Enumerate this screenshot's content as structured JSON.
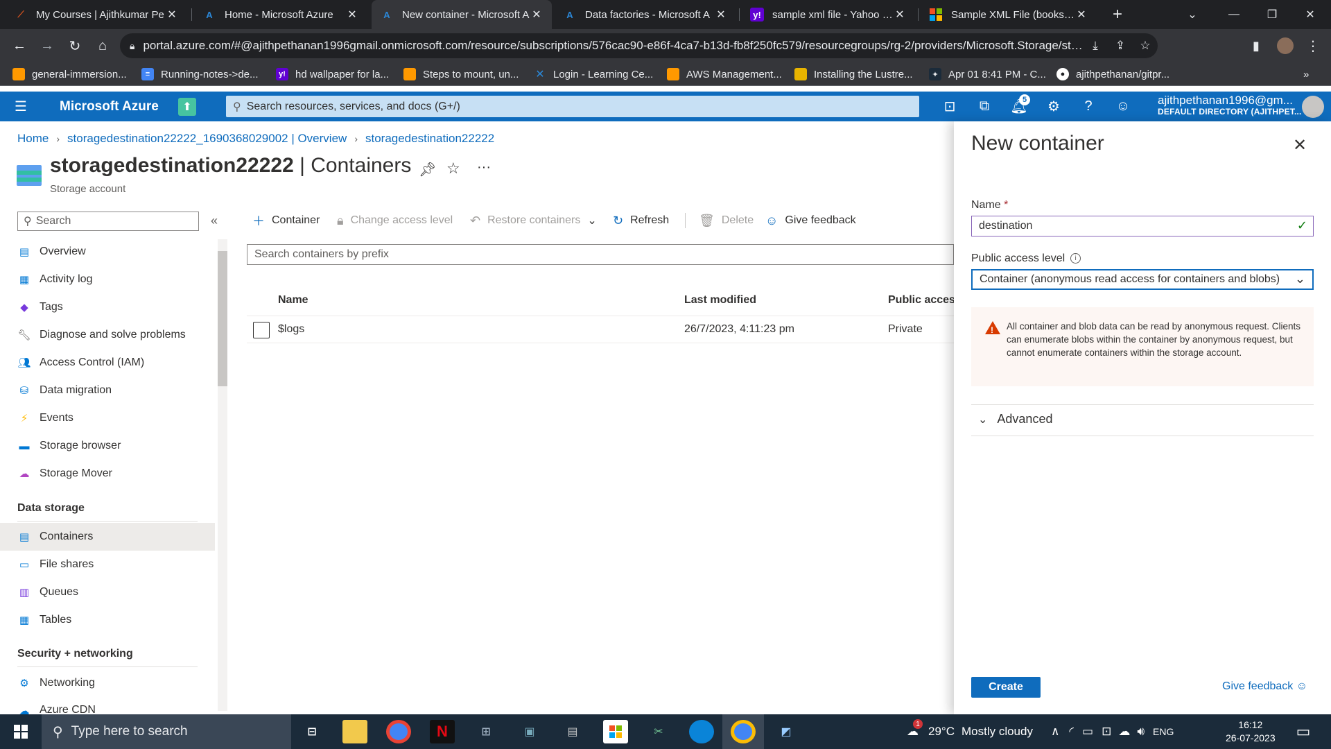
{
  "browser": {
    "tabs": [
      {
        "title": "My Courses | Ajithkumar Pe",
        "icon": "courses-favicon",
        "icon_color": "#d9541e"
      },
      {
        "title": "Home - Microsoft Azure",
        "icon": "azure-favicon",
        "icon_color": "#2b88d8"
      },
      {
        "title": "New container - Microsoft A",
        "icon": "azure-favicon",
        "icon_color": "#2b88d8",
        "active": true
      },
      {
        "title": "Data factories - Microsoft A",
        "icon": "azure-favicon",
        "icon_color": "#2b88d8"
      },
      {
        "title": "sample xml file - Yahoo Ind",
        "icon": "yahoo-favicon",
        "icon_color": "#6001d2"
      },
      {
        "title": "Sample XML File (books.xm",
        "icon": "microsoft-favicon",
        "icon_color": "#f25022"
      }
    ],
    "url": "portal.azure.com/#@ajithpethanan1996gmail.onmicrosoft.com/resource/subscriptions/576cac90-e86f-4ca7-b13d-fb8f250fc579/resourcegroups/rg-2/providers/Microsoft.Storage/storag...",
    "bookmarks": [
      {
        "label": "general-immersion...",
        "icon": "aws-icon",
        "color": "#ff9900"
      },
      {
        "label": "Running-notes->de...",
        "icon": "doc-icon",
        "color": "#4285f4"
      },
      {
        "label": "hd wallpaper for la...",
        "icon": "yahoo-icon",
        "color": "#6001d2"
      },
      {
        "label": "Steps to mount, un...",
        "icon": "aws-icon",
        "color": "#ff9900"
      },
      {
        "label": "Login - Learning Ce...",
        "icon": "learning-icon",
        "color": "#2b88d8"
      },
      {
        "label": "AWS Management...",
        "icon": "aws-icon",
        "color": "#ff9900"
      },
      {
        "label": "Installing the Lustre...",
        "icon": "package-icon",
        "color": "#e8b400"
      },
      {
        "label": "Apr 01 8:41 PM - C...",
        "icon": "calendar-icon",
        "color": "#1b2b3a"
      },
      {
        "label": "ajithpethanan/gitpr...",
        "icon": "github-icon",
        "color": "#ffffff"
      }
    ],
    "more_bookmarks": "»"
  },
  "azure": {
    "brand": "Microsoft Azure",
    "search_placeholder": "Search resources, services, and docs (G+/)",
    "notification_count": "5",
    "account_email": "ajithpethanan1996@gm...",
    "account_dir": "DEFAULT DIRECTORY (AJITHPET..."
  },
  "breadcrumb": [
    "Home",
    "storagedestination22222_1690368029002 | Overview",
    "storagedestination22222"
  ],
  "page": {
    "resource": "storagedestination22222",
    "section": " | Containers",
    "subtitle": "Storage account"
  },
  "nav": {
    "search_placeholder": "Search",
    "collapse": "«",
    "items": [
      {
        "label": "Overview",
        "icon": "overview-icon",
        "color": "#0078d4"
      },
      {
        "label": "Activity log",
        "icon": "activity-log-icon",
        "color": "#0078d4"
      },
      {
        "label": "Tags",
        "icon": "tag-icon",
        "color": "#773adc"
      },
      {
        "label": "Diagnose and solve problems",
        "icon": "wrench-icon",
        "color": "#605e5c"
      },
      {
        "label": "Access Control (IAM)",
        "icon": "people-icon",
        "color": "#0078d4"
      },
      {
        "label": "Data migration",
        "icon": "migration-icon",
        "color": "#0078d4"
      },
      {
        "label": "Events",
        "icon": "lightning-icon",
        "color": "#ffb900"
      },
      {
        "label": "Storage browser",
        "icon": "storage-browser-icon",
        "color": "#0078d4"
      },
      {
        "label": "Storage Mover",
        "icon": "cloud-icon",
        "color": "#b146c2"
      }
    ],
    "section_data_storage": "Data storage",
    "data_items": [
      {
        "label": "Containers",
        "icon": "containers-icon",
        "color": "#0078d4",
        "selected": true
      },
      {
        "label": "File shares",
        "icon": "file-shares-icon",
        "color": "#0078d4"
      },
      {
        "label": "Queues",
        "icon": "queues-icon",
        "color": "#773adc"
      },
      {
        "label": "Tables",
        "icon": "tables-icon",
        "color": "#0078d4"
      }
    ],
    "section_security": "Security + networking",
    "security_items": [
      {
        "label": "Networking",
        "icon": "networking-icon",
        "color": "#0078d4"
      },
      {
        "label": "Azure CDN",
        "icon": "cdn-icon",
        "color": "#0078d4"
      }
    ]
  },
  "toolbar": {
    "add_container": "Container",
    "change_access": "Change access level",
    "restore": "Restore containers",
    "refresh": "Refresh",
    "delete": "Delete",
    "feedback": "Give feedback"
  },
  "containers": {
    "search_placeholder": "Search containers by prefix",
    "columns": [
      "Name",
      "Last modified",
      "Public access"
    ],
    "rows": [
      {
        "name": "$logs",
        "modified": "26/7/2023, 4:11:23 pm",
        "access": "Private"
      }
    ]
  },
  "panel": {
    "title": "New container",
    "name_label": "Name",
    "required_mark": "*",
    "name_value": "destination",
    "access_label": "Public access level",
    "access_value": "Container (anonymous read access for containers and blobs)",
    "warning": "All container and blob data can be read by anonymous request. Clients can enumerate blobs within the container by anonymous request, but cannot enumerate containers within the storage account.",
    "advanced": "Advanced",
    "create": "Create",
    "feedback": "Give feedback"
  },
  "taskbar": {
    "search_placeholder": "Type here to search",
    "weather_temp": "29°C",
    "weather_text": "Mostly cloudy",
    "weather_badge": "1",
    "lang": "ENG",
    "time": "16:12",
    "date": "26-07-2023"
  }
}
